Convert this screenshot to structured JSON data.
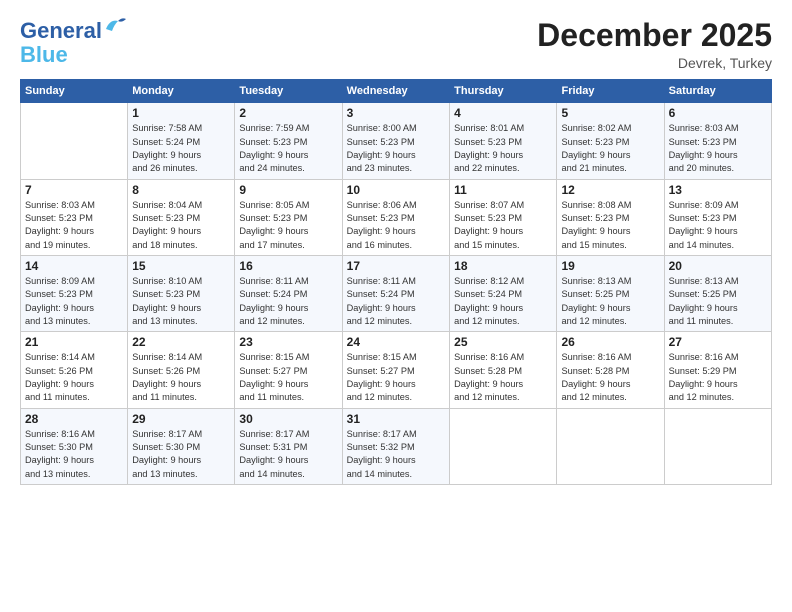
{
  "header": {
    "logo_general": "General",
    "logo_blue": "Blue",
    "month_title": "December 2025",
    "subtitle": "Devrek, Turkey"
  },
  "weekdays": [
    "Sunday",
    "Monday",
    "Tuesday",
    "Wednesday",
    "Thursday",
    "Friday",
    "Saturday"
  ],
  "weeks": [
    [
      {
        "day": "",
        "info": ""
      },
      {
        "day": "1",
        "info": "Sunrise: 7:58 AM\nSunset: 5:24 PM\nDaylight: 9 hours\nand 26 minutes."
      },
      {
        "day": "2",
        "info": "Sunrise: 7:59 AM\nSunset: 5:23 PM\nDaylight: 9 hours\nand 24 minutes."
      },
      {
        "day": "3",
        "info": "Sunrise: 8:00 AM\nSunset: 5:23 PM\nDaylight: 9 hours\nand 23 minutes."
      },
      {
        "day": "4",
        "info": "Sunrise: 8:01 AM\nSunset: 5:23 PM\nDaylight: 9 hours\nand 22 minutes."
      },
      {
        "day": "5",
        "info": "Sunrise: 8:02 AM\nSunset: 5:23 PM\nDaylight: 9 hours\nand 21 minutes."
      },
      {
        "day": "6",
        "info": "Sunrise: 8:03 AM\nSunset: 5:23 PM\nDaylight: 9 hours\nand 20 minutes."
      }
    ],
    [
      {
        "day": "7",
        "info": "Sunrise: 8:03 AM\nSunset: 5:23 PM\nDaylight: 9 hours\nand 19 minutes."
      },
      {
        "day": "8",
        "info": "Sunrise: 8:04 AM\nSunset: 5:23 PM\nDaylight: 9 hours\nand 18 minutes."
      },
      {
        "day": "9",
        "info": "Sunrise: 8:05 AM\nSunset: 5:23 PM\nDaylight: 9 hours\nand 17 minutes."
      },
      {
        "day": "10",
        "info": "Sunrise: 8:06 AM\nSunset: 5:23 PM\nDaylight: 9 hours\nand 16 minutes."
      },
      {
        "day": "11",
        "info": "Sunrise: 8:07 AM\nSunset: 5:23 PM\nDaylight: 9 hours\nand 15 minutes."
      },
      {
        "day": "12",
        "info": "Sunrise: 8:08 AM\nSunset: 5:23 PM\nDaylight: 9 hours\nand 15 minutes."
      },
      {
        "day": "13",
        "info": "Sunrise: 8:09 AM\nSunset: 5:23 PM\nDaylight: 9 hours\nand 14 minutes."
      }
    ],
    [
      {
        "day": "14",
        "info": "Sunrise: 8:09 AM\nSunset: 5:23 PM\nDaylight: 9 hours\nand 13 minutes."
      },
      {
        "day": "15",
        "info": "Sunrise: 8:10 AM\nSunset: 5:23 PM\nDaylight: 9 hours\nand 13 minutes."
      },
      {
        "day": "16",
        "info": "Sunrise: 8:11 AM\nSunset: 5:24 PM\nDaylight: 9 hours\nand 12 minutes."
      },
      {
        "day": "17",
        "info": "Sunrise: 8:11 AM\nSunset: 5:24 PM\nDaylight: 9 hours\nand 12 minutes."
      },
      {
        "day": "18",
        "info": "Sunrise: 8:12 AM\nSunset: 5:24 PM\nDaylight: 9 hours\nand 12 minutes."
      },
      {
        "day": "19",
        "info": "Sunrise: 8:13 AM\nSunset: 5:25 PM\nDaylight: 9 hours\nand 12 minutes."
      },
      {
        "day": "20",
        "info": "Sunrise: 8:13 AM\nSunset: 5:25 PM\nDaylight: 9 hours\nand 11 minutes."
      }
    ],
    [
      {
        "day": "21",
        "info": "Sunrise: 8:14 AM\nSunset: 5:26 PM\nDaylight: 9 hours\nand 11 minutes."
      },
      {
        "day": "22",
        "info": "Sunrise: 8:14 AM\nSunset: 5:26 PM\nDaylight: 9 hours\nand 11 minutes."
      },
      {
        "day": "23",
        "info": "Sunrise: 8:15 AM\nSunset: 5:27 PM\nDaylight: 9 hours\nand 11 minutes."
      },
      {
        "day": "24",
        "info": "Sunrise: 8:15 AM\nSunset: 5:27 PM\nDaylight: 9 hours\nand 12 minutes."
      },
      {
        "day": "25",
        "info": "Sunrise: 8:16 AM\nSunset: 5:28 PM\nDaylight: 9 hours\nand 12 minutes."
      },
      {
        "day": "26",
        "info": "Sunrise: 8:16 AM\nSunset: 5:28 PM\nDaylight: 9 hours\nand 12 minutes."
      },
      {
        "day": "27",
        "info": "Sunrise: 8:16 AM\nSunset: 5:29 PM\nDaylight: 9 hours\nand 12 minutes."
      }
    ],
    [
      {
        "day": "28",
        "info": "Sunrise: 8:16 AM\nSunset: 5:30 PM\nDaylight: 9 hours\nand 13 minutes."
      },
      {
        "day": "29",
        "info": "Sunrise: 8:17 AM\nSunset: 5:30 PM\nDaylight: 9 hours\nand 13 minutes."
      },
      {
        "day": "30",
        "info": "Sunrise: 8:17 AM\nSunset: 5:31 PM\nDaylight: 9 hours\nand 14 minutes."
      },
      {
        "day": "31",
        "info": "Sunrise: 8:17 AM\nSunset: 5:32 PM\nDaylight: 9 hours\nand 14 minutes."
      },
      {
        "day": "",
        "info": ""
      },
      {
        "day": "",
        "info": ""
      },
      {
        "day": "",
        "info": ""
      }
    ]
  ]
}
